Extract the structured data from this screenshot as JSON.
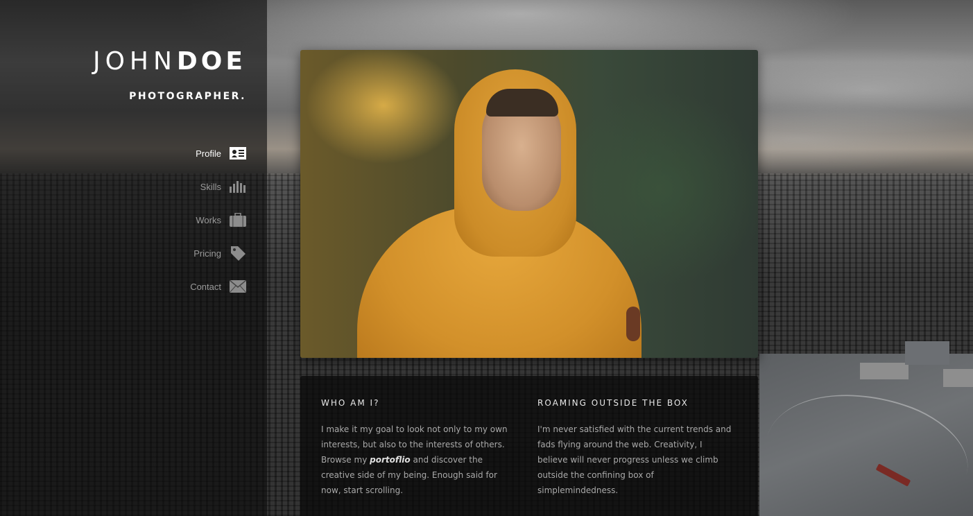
{
  "brand": {
    "first": "JOHN",
    "last": "DOE",
    "role": "PHOTOGRAPHER."
  },
  "nav": [
    {
      "label": "Profile",
      "icon": "profile-card-icon",
      "active": true
    },
    {
      "label": "Skills",
      "icon": "bar-chart-icon",
      "active": false
    },
    {
      "label": "Works",
      "icon": "briefcase-icon",
      "active": false
    },
    {
      "label": "Pricing",
      "icon": "price-tag-icon",
      "active": false
    },
    {
      "label": "Contact",
      "icon": "envelope-icon",
      "active": false
    }
  ],
  "hero_image": {
    "subject": "portrait of man in yellow hooded jacket"
  },
  "about": {
    "heading": "WHO AM I?",
    "text_before": "I make it my goal to look not only to my own interests, but also to the interests of others. Browse my ",
    "link_text": "portoflio",
    "text_after": " and discover the creative side of my being. Enough said for now, start scrolling."
  },
  "philosophy": {
    "heading": "ROAMING OUTSIDE THE BOX",
    "text": "I'm never satisfied with the current trends and fads flying around the web. Creativity, I believe will never progress unless we climb outside the confining box of simplemindedness."
  },
  "colors": {
    "sidebar_bg": "#0c0c0c",
    "nav_inactive": "#9a9a9a",
    "nav_active": "#ffffff",
    "jacket": "#d2902a"
  }
}
